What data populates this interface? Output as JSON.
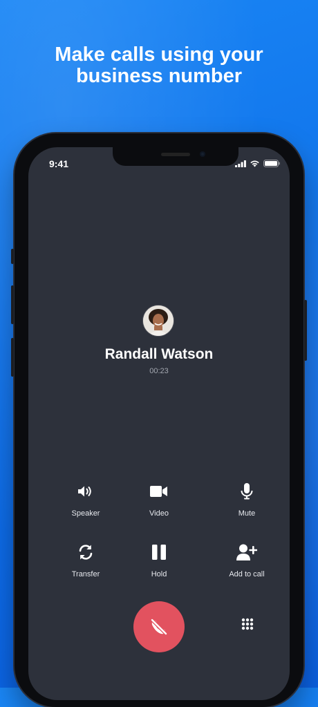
{
  "headline": {
    "line1": "Make calls using your",
    "line2": "business number"
  },
  "status_bar": {
    "time": "9:41",
    "icons": [
      "cellular-signal-icon",
      "wifi-icon",
      "battery-icon"
    ]
  },
  "call": {
    "caller_name": "Randall Watson",
    "duration": "00:23"
  },
  "controls": [
    {
      "label": "Speaker",
      "icon": "speaker-icon"
    },
    {
      "label": "Video",
      "icon": "video-camera-icon"
    },
    {
      "label": "Mute",
      "icon": "microphone-icon"
    },
    {
      "label": "Transfer",
      "icon": "transfer-icon"
    },
    {
      "label": "Hold",
      "icon": "pause-icon"
    },
    {
      "label": "Add to call",
      "icon": "add-person-icon"
    }
  ],
  "actions": {
    "end_call_icon": "end-call-icon",
    "keypad_icon": "dialpad-icon"
  },
  "colors": {
    "background": "#0f72ea",
    "screen": "#2d313b",
    "end_call": "#e2525f",
    "text_secondary": "#a4a8b1"
  }
}
